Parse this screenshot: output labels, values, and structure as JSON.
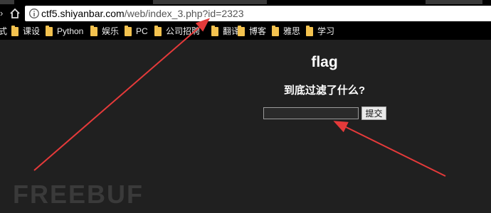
{
  "browser": {
    "url_host": "ctf5.shiyanbar.com",
    "url_rest": "/web/index_3.php?id=2323",
    "bookmarks_lead": "式",
    "bookmarks": [
      {
        "label": "课设"
      },
      {
        "label": "Python"
      },
      {
        "label": "娱乐"
      },
      {
        "label": "PC"
      },
      {
        "label": "公司招聘"
      },
      {
        "label": "翻译"
      },
      {
        "label": "博客"
      },
      {
        "label": "雅思"
      },
      {
        "label": "学习"
      }
    ]
  },
  "page": {
    "title": "flag",
    "question": "到底过滤了什么?",
    "input_value": "",
    "submit_label": "提交"
  },
  "watermark": "FREEBUF",
  "colors": {
    "background": "#202020",
    "annotation_arrow": "#e53a3a",
    "folder": "#f3c24f"
  }
}
